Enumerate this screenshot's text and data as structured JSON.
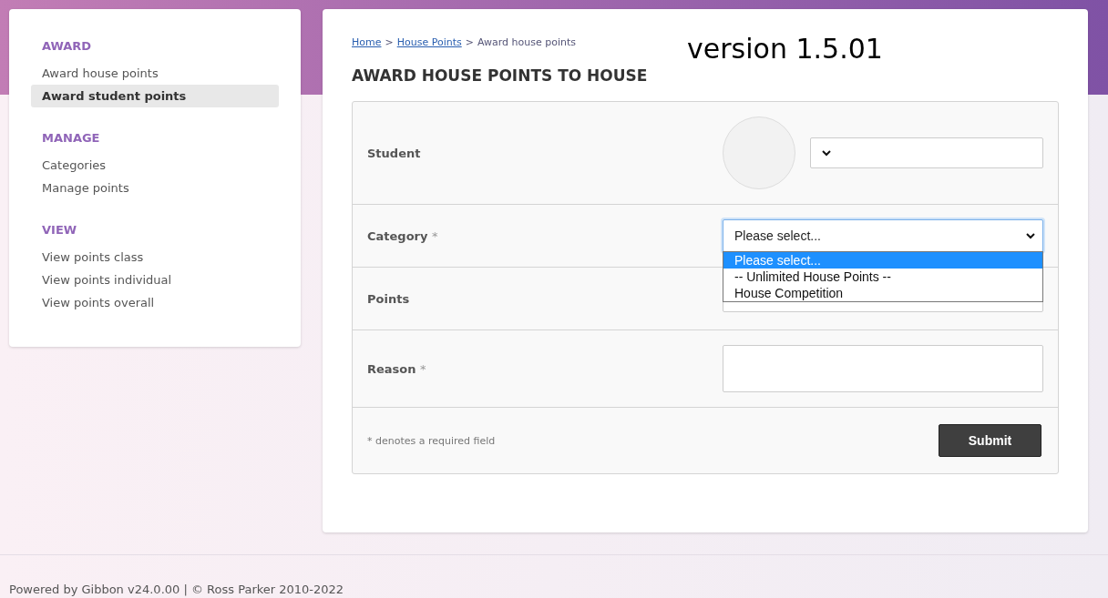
{
  "sidebar": {
    "sections": [
      {
        "title": "AWARD",
        "items": [
          {
            "label": "Award house points",
            "selected": false
          },
          {
            "label": "Award student points",
            "selected": true
          }
        ]
      },
      {
        "title": "MANAGE",
        "items": [
          {
            "label": "Categories",
            "selected": false
          },
          {
            "label": "Manage points",
            "selected": false
          }
        ]
      },
      {
        "title": "VIEW",
        "items": [
          {
            "label": "View points class",
            "selected": false
          },
          {
            "label": "View points individual",
            "selected": false
          },
          {
            "label": "View points overall",
            "selected": false
          }
        ]
      }
    ]
  },
  "breadcrumb": [
    {
      "label": "Home",
      "kind": "link"
    },
    {
      "label": ">",
      "kind": "separator"
    },
    {
      "label": "House Points",
      "kind": "link"
    },
    {
      "label": ">",
      "kind": "separator"
    },
    {
      "label": "Award house points",
      "kind": "current"
    }
  ],
  "version": "version 1.5.01",
  "title": "AWARD HOUSE POINTS TO HOUSE",
  "form": {
    "rows": [
      {
        "label": "Student",
        "required": false,
        "kind": "student-select"
      },
      {
        "label": "Category",
        "required": true,
        "kind": "select",
        "value": "Please select...",
        "expanded": true,
        "options": [
          {
            "label": "Please select...",
            "selected": true
          },
          {
            "label": "-- Unlimited House Points --",
            "selected": false
          },
          {
            "label": "House Competition",
            "selected": false
          }
        ]
      },
      {
        "label": "Points",
        "required": false,
        "kind": "text"
      },
      {
        "label": "Reason",
        "required": true,
        "kind": "textarea"
      }
    ],
    "required_mark": "*",
    "required_note": "* denotes a required field",
    "submit": "Submit"
  },
  "footer": "Powered by Gibbon v24.0.00 | © Ross Parker 2010-2022"
}
